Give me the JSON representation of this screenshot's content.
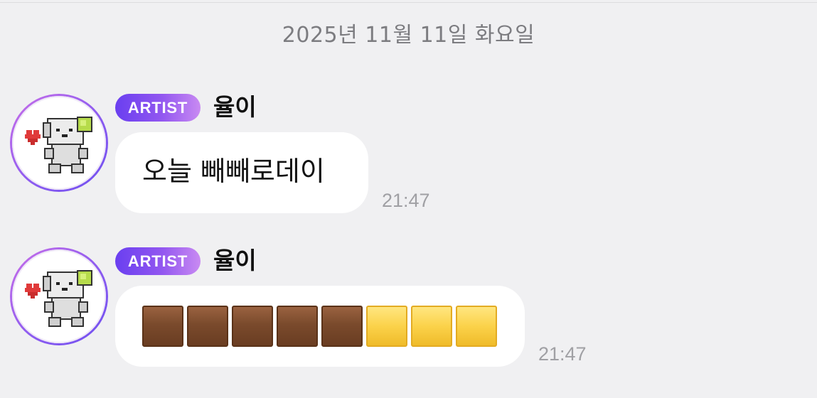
{
  "date_separator": "2025년 11월 11일 화요일",
  "messages": [
    {
      "badge": "ARTIST",
      "sender": "율이",
      "text": "오늘 빼빼로데이",
      "time": "21:47"
    },
    {
      "badge": "ARTIST",
      "sender": "율이",
      "emoji_squares": [
        "brown-square",
        "brown-square",
        "brown-square",
        "brown-square",
        "brown-square",
        "yellow-square",
        "yellow-square",
        "yellow-square"
      ],
      "time": "21:47"
    }
  ],
  "colors": {
    "background": "#f0f0f2",
    "bubble": "#ffffff",
    "badge_gradient_start": "#6a3ff0",
    "badge_gradient_end": "#c98af2",
    "brown_square": "#7a4a2c",
    "yellow_square": "#fbd24a"
  },
  "icons": {
    "avatar": "pixel-puppy-avatar"
  }
}
